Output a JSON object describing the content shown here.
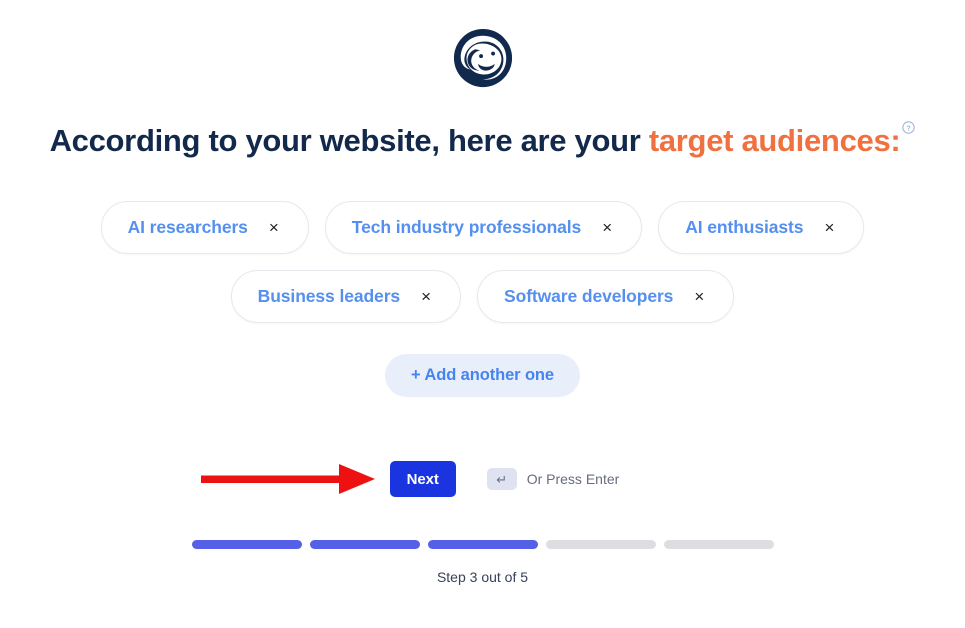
{
  "brand": {
    "logo_icon": "sloth-face-logo",
    "logo_color": "#11294d"
  },
  "headline": {
    "lead": "According to your website, here are your ",
    "accent": "target audiences:",
    "accent_color": "#f0703f",
    "text_color": "#12294c",
    "info_icon": "question-circle-icon"
  },
  "audiences": {
    "close_glyph": "×",
    "tags": [
      {
        "label": "AI researchers"
      },
      {
        "label": "Tech industry professionals"
      },
      {
        "label": "AI enthusiasts"
      },
      {
        "label": "Business leaders"
      },
      {
        "label": "Software developers"
      }
    ],
    "add_label": "+ Add another one"
  },
  "actions": {
    "next_label": "Next",
    "next_color": "#1a34df",
    "enter_key_glyph": "↵",
    "enter_hint": "Or Press Enter",
    "annotation_arrow": {
      "icon": "red-arrow-annotation",
      "color": "#ee1111",
      "points_to": "next-button"
    }
  },
  "progress": {
    "total_steps": 5,
    "current_step": 3,
    "filled_color": "#5560e6",
    "empty_color": "#dcdee2",
    "step_text": "Step 3 out of 5"
  }
}
